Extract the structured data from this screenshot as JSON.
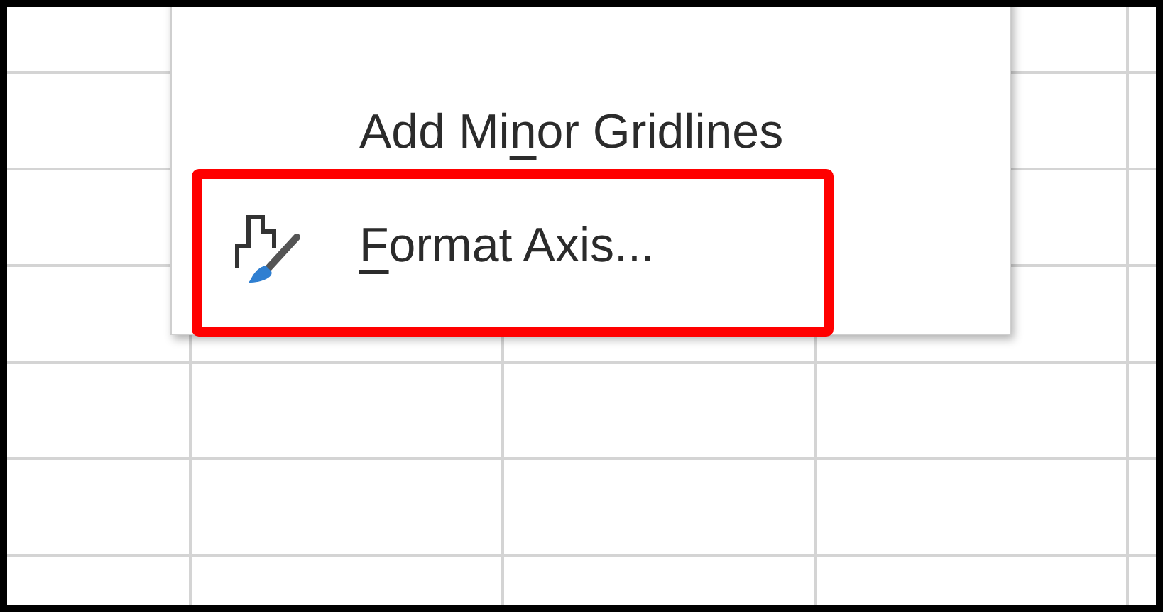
{
  "context_menu": {
    "items": [
      {
        "label_before": "Add Mi",
        "access_key": "n",
        "label_after": "or Gridlines",
        "icon": false,
        "highlighted": false
      },
      {
        "access_key": "F",
        "label_after": "ormat Axis...",
        "icon": true,
        "highlighted": true
      }
    ]
  }
}
